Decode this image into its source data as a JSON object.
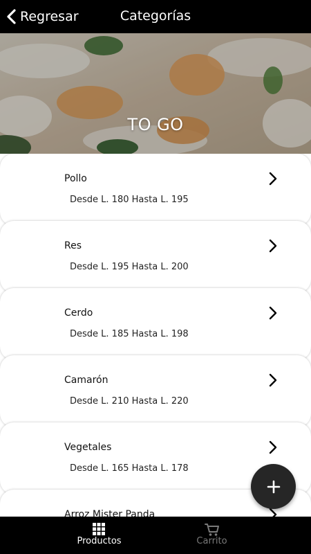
{
  "header": {
    "back_label": "Regresar",
    "title": "Categorías"
  },
  "hero": {
    "title": "TO GO"
  },
  "categories": [
    {
      "name": "Pollo",
      "range": "Desde L. 180 Hasta L. 195"
    },
    {
      "name": "Res",
      "range": "Desde L. 195 Hasta L. 200"
    },
    {
      "name": "Cerdo",
      "range": "Desde L. 185 Hasta L. 198"
    },
    {
      "name": "Camarón",
      "range": "Desde L. 210 Hasta L. 220"
    },
    {
      "name": "Vegetales",
      "range": "Desde L. 165 Hasta L. 178"
    },
    {
      "name": "Arroz Mister Panda",
      "range": ""
    }
  ],
  "fab": {
    "icon": "plus-icon"
  },
  "nav": {
    "items": [
      {
        "label": "Productos",
        "icon": "grid-icon",
        "active": true
      },
      {
        "label": "Carrito",
        "icon": "cart-icon",
        "active": false
      }
    ]
  },
  "colors": {
    "bar": "#000000",
    "fab": "#262626",
    "inactive": "#7a7a7a"
  }
}
